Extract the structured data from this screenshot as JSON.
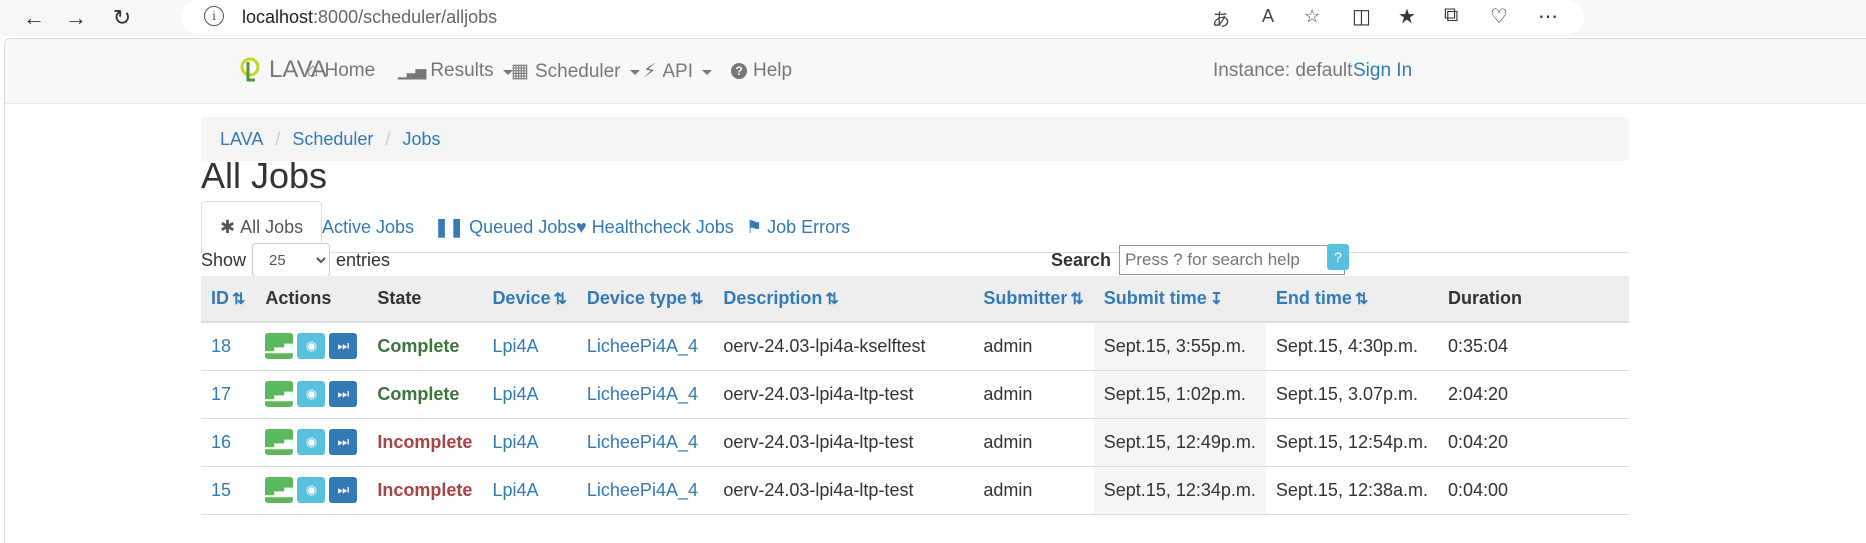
{
  "browser": {
    "url_host": "localhost",
    "url_path": ":8000/scheduler/alljobs"
  },
  "navbar": {
    "brand": "LAVA",
    "home": "Home",
    "results": "Results",
    "scheduler": "Scheduler",
    "api": "API",
    "help": "Help",
    "instance": "Instance: default",
    "signin": "Sign In"
  },
  "breadcrumb": [
    "LAVA",
    "Scheduler",
    "Jobs"
  ],
  "page_title": "All Jobs",
  "tabs": [
    "All Jobs",
    "Active Jobs",
    "Queued Jobs",
    "Healthcheck Jobs",
    "Job Errors"
  ],
  "show": {
    "label": "Show",
    "value": "25",
    "suffix": "entries"
  },
  "search": {
    "label": "Search",
    "placeholder": "Press ? for search help",
    "help": "?"
  },
  "table": {
    "headers": [
      "ID",
      "Actions",
      "State",
      "Device",
      "Device type",
      "Description",
      "Submitter",
      "Submit time",
      "End time",
      "Duration"
    ],
    "rows": [
      {
        "id": "18",
        "state": "Complete",
        "device": "Lpi4A",
        "device_type": "LicheePi4A_4",
        "description": "oerv-24.03-lpi4a-kselftest",
        "submitter": "admin",
        "submit_time": "Sept.15, 3:55p.m.",
        "end_time": "Sept.15, 4:30p.m.",
        "duration": "0:35:04"
      },
      {
        "id": "17",
        "state": "Complete",
        "device": "Lpi4A",
        "device_type": "LicheePi4A_4",
        "description": "oerv-24.03-lpi4a-ltp-test",
        "submitter": "admin",
        "submit_time": "Sept.15, 1:02p.m.",
        "end_time": "Sept.15, 3.07p.m.",
        "duration": "2:04:20"
      },
      {
        "id": "16",
        "state": "Incomplete",
        "device": "Lpi4A",
        "device_type": "LicheePi4A_4",
        "description": "oerv-24.03-lpi4a-ltp-test",
        "submitter": "admin",
        "submit_time": "Sept.15, 12:49p.m.",
        "end_time": "Sept.15, 12:54p.m.",
        "duration": "0:04:20"
      },
      {
        "id": "15",
        "state": "Incomplete",
        "device": "Lpi4A",
        "device_type": "LicheePi4A_4",
        "description": "oerv-24.03-lpi4a-ltp-test",
        "submitter": "admin",
        "submit_time": "Sept.15, 12:34p.m.",
        "end_time": "Sept.15, 12:38a.m.",
        "duration": "0:04:00"
      }
    ]
  },
  "colors": {
    "link": "#337ab7",
    "complete": "#3c763d",
    "incomplete": "#a94442"
  }
}
